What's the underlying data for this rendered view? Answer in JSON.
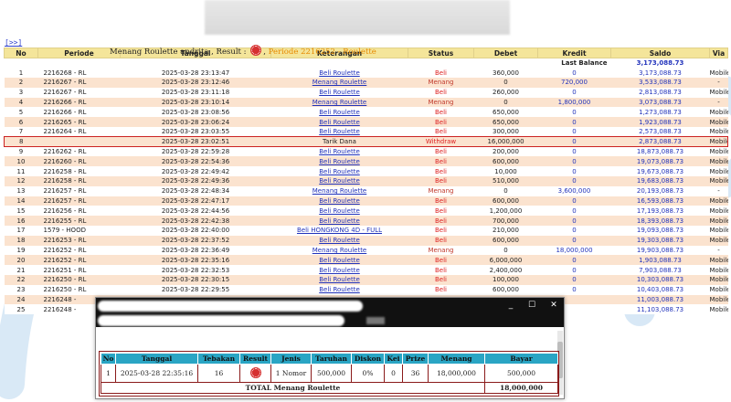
{
  "nav": {
    "next_label": "[>>]"
  },
  "table": {
    "headers": [
      "No",
      "Periode",
      "Tanggal",
      "Keterangan",
      "Status",
      "Debet",
      "Kredit",
      "Saldo",
      "Via"
    ],
    "last_balance_label": "Last Balance",
    "last_balance_value": "3,173,088.73",
    "rows": [
      {
        "no": "1",
        "periode": "2216268 - RL",
        "tanggal": "2025-03-28 23:13:47",
        "ket": "Beli Roulette",
        "status": "Beli",
        "debet": "360,000",
        "kredit": "0",
        "saldo": "3,173,088.73",
        "via": "Mobile"
      },
      {
        "no": "2",
        "periode": "2216267 - RL",
        "tanggal": "2025-03-28 23:12:46",
        "ket": "Menang Roulette",
        "status": "Menang",
        "debet": "0",
        "kredit": "720,000",
        "saldo": "3,533,088.73",
        "via": "-"
      },
      {
        "no": "3",
        "periode": "2216267 - RL",
        "tanggal": "2025-03-28 23:11:18",
        "ket": "Beli Roulette",
        "status": "Beli",
        "debet": "260,000",
        "kredit": "0",
        "saldo": "2,813,088.73",
        "via": "Mobile"
      },
      {
        "no": "4",
        "periode": "2216266 - RL",
        "tanggal": "2025-03-28 23:10:14",
        "ket": "Menang Roulette",
        "status": "Menang",
        "debet": "0",
        "kredit": "1,800,000",
        "saldo": "3,073,088.73",
        "via": "-"
      },
      {
        "no": "5",
        "periode": "2216266 - RL",
        "tanggal": "2025-03-28 23:08:56",
        "ket": "Beli Roulette",
        "status": "Beli",
        "debet": "650,000",
        "kredit": "0",
        "saldo": "1,273,088.73",
        "via": "Mobile"
      },
      {
        "no": "6",
        "periode": "2216265 - RL",
        "tanggal": "2025-03-28 23:06:24",
        "ket": "Beli Roulette",
        "status": "Beli",
        "debet": "650,000",
        "kredit": "0",
        "saldo": "1,923,088.73",
        "via": "Mobile"
      },
      {
        "no": "7",
        "periode": "2216264 - RL",
        "tanggal": "2025-03-28 23:03:55",
        "ket": "Beli Roulette",
        "status": "Beli",
        "debet": "300,000",
        "kredit": "0",
        "saldo": "2,573,088.73",
        "via": "Mobile"
      },
      {
        "no": "8",
        "periode": "",
        "tanggal": "2025-03-28 23:02:51",
        "ket": "Tarik Dana",
        "status": "Withdraw",
        "debet": "16,000,000",
        "kredit": "0",
        "saldo": "2,873,088.73",
        "via": "Mobile"
      },
      {
        "no": "9",
        "periode": "2216262 - RL",
        "tanggal": "2025-03-28 22:59:28",
        "ket": "Beli Roulette",
        "status": "Beli",
        "debet": "200,000",
        "kredit": "0",
        "saldo": "18,873,088.73",
        "via": "Mobile"
      },
      {
        "no": "10",
        "periode": "2216260 - RL",
        "tanggal": "2025-03-28 22:54:36",
        "ket": "Beli Roulette",
        "status": "Beli",
        "debet": "600,000",
        "kredit": "0",
        "saldo": "19,073,088.73",
        "via": "Mobile"
      },
      {
        "no": "11",
        "periode": "2216258 - RL",
        "tanggal": "2025-03-28 22:49:42",
        "ket": "Beli Roulette",
        "status": "Beli",
        "debet": "10,000",
        "kredit": "0",
        "saldo": "19,673,088.73",
        "via": "Mobile"
      },
      {
        "no": "12",
        "periode": "2216258 - RL",
        "tanggal": "2025-03-28 22:49:36",
        "ket": "Beli Roulette",
        "status": "Beli",
        "debet": "510,000",
        "kredit": "0",
        "saldo": "19,683,088.73",
        "via": "Mobile"
      },
      {
        "no": "13",
        "periode": "2216257 - RL",
        "tanggal": "2025-03-28 22:48:34",
        "ket": "Menang Roulette",
        "status": "Menang",
        "debet": "0",
        "kredit": "3,600,000",
        "saldo": "20,193,088.73",
        "via": "-"
      },
      {
        "no": "14",
        "periode": "2216257 - RL",
        "tanggal": "2025-03-28 22:47:17",
        "ket": "Beli Roulette",
        "status": "Beli",
        "debet": "600,000",
        "kredit": "0",
        "saldo": "16,593,088.73",
        "via": "Mobile"
      },
      {
        "no": "15",
        "periode": "2216256 - RL",
        "tanggal": "2025-03-28 22:44:56",
        "ket": "Beli Roulette",
        "status": "Beli",
        "debet": "1,200,000",
        "kredit": "0",
        "saldo": "17,193,088.73",
        "via": "Mobile"
      },
      {
        "no": "16",
        "periode": "2216255 - RL",
        "tanggal": "2025-03-28 22:42:38",
        "ket": "Beli Roulette",
        "status": "Beli",
        "debet": "700,000",
        "kredit": "0",
        "saldo": "18,393,088.73",
        "via": "Mobile"
      },
      {
        "no": "17",
        "periode": "1579 - HOOD",
        "tanggal": "2025-03-28 22:40:00",
        "ket": "Beli HONGKONG 4D - FULL",
        "status": "Beli",
        "debet": "210,000",
        "kredit": "0",
        "saldo": "19,093,088.73",
        "via": "Mobile"
      },
      {
        "no": "18",
        "periode": "2216253 - RL",
        "tanggal": "2025-03-28 22:37:52",
        "ket": "Beli Roulette",
        "status": "Beli",
        "debet": "600,000",
        "kredit": "0",
        "saldo": "19,303,088.73",
        "via": "Mobile"
      },
      {
        "no": "19",
        "periode": "2216252 - RL",
        "tanggal": "2025-03-28 22:36:49",
        "ket": "Menang Roulette",
        "status": "Menang",
        "debet": "0",
        "kredit": "18,000,000",
        "saldo": "19,903,088.73",
        "via": "-"
      },
      {
        "no": "20",
        "periode": "2216252 - RL",
        "tanggal": "2025-03-28 22:35:16",
        "ket": "Beli Roulette",
        "status": "Beli",
        "debet": "6,000,000",
        "kredit": "0",
        "saldo": "1,903,088.73",
        "via": "Mobile"
      },
      {
        "no": "21",
        "periode": "2216251 - RL",
        "tanggal": "2025-03-28 22:32:53",
        "ket": "Beli Roulette",
        "status": "Beli",
        "debet": "2,400,000",
        "kredit": "0",
        "saldo": "7,903,088.73",
        "via": "Mobile"
      },
      {
        "no": "22",
        "periode": "2216250 - RL",
        "tanggal": "2025-03-28 22:30:15",
        "ket": "Beli Roulette",
        "status": "Beli",
        "debet": "100,000",
        "kredit": "0",
        "saldo": "10,303,088.73",
        "via": "Mobile"
      },
      {
        "no": "23",
        "periode": "2216250 - RL",
        "tanggal": "2025-03-28 22:29:55",
        "ket": "Beli Roulette",
        "status": "Beli",
        "debet": "600,000",
        "kredit": "0",
        "saldo": "10,403,088.73",
        "via": "Mobile"
      },
      {
        "no": "24",
        "periode": "2216248 -",
        "tanggal": "",
        "ket": "",
        "status": "",
        "debet": "",
        "kredit": "",
        "saldo": "11,003,088.73",
        "via": "Mobile"
      },
      {
        "no": "25",
        "periode": "2216248 -",
        "tanggal": "",
        "ket": "",
        "status": "",
        "debet": "",
        "kredit": "",
        "saldo": "11,103,088.73",
        "via": "Mobile"
      }
    ]
  },
  "popup": {
    "heading_prefix": "Menang Roulette andrita , Result :",
    "heading_periode": "Periode 2216252 - Roulette",
    "window_controls": {
      "minimize": "_",
      "maximize": "☐",
      "close": "✕"
    },
    "headers": [
      "No",
      "Tanggal",
      "Tebakan",
      "Result",
      "Jenis",
      "Taruhan",
      "Diskon",
      "Kei",
      "Prize",
      "Menang",
      "Bayar"
    ],
    "row": {
      "no": "1",
      "tanggal": "2025-03-28 22:35:16",
      "tebakan": "16",
      "jenis": "1 Nomor",
      "taruhan": "500,000",
      "diskon": "0%",
      "kei": "0",
      "prize": "36",
      "menang": "18,000,000",
      "bayar": "500,000"
    },
    "total_label": "TOTAL Menang Roulette",
    "total_value": "18,000,000"
  },
  "colors": {
    "header_bg": "#f4e59a",
    "row_alt": "#fbe3cf",
    "link": "#2233bb",
    "status_red": "#d22",
    "highlight_border": "#cc2222",
    "popup_header": "#2aa5c4"
  }
}
